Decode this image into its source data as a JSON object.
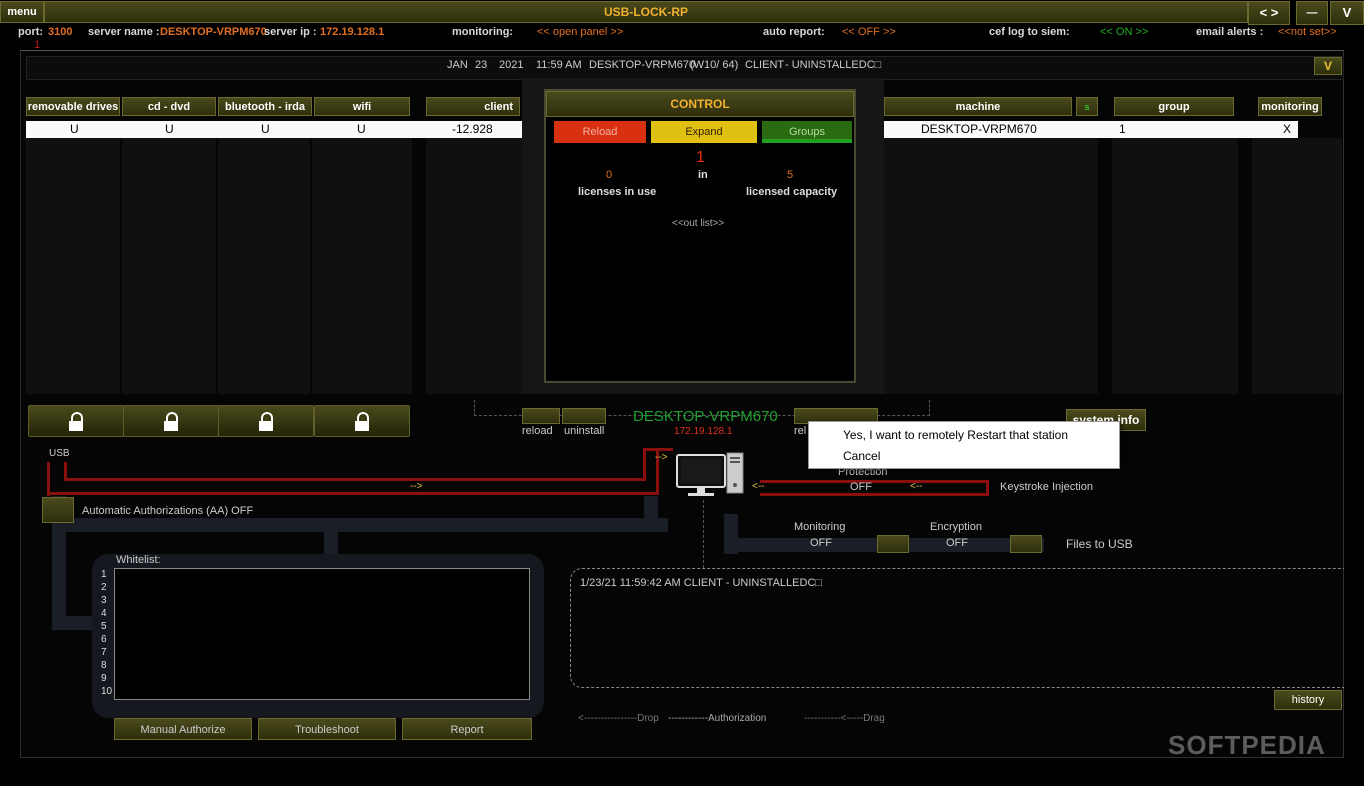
{
  "titlebar": {
    "menu": "menu",
    "title": "USB-LOCK-RP",
    "nav": "< >",
    "minimize": "—",
    "maximize": "V"
  },
  "statusbar": {
    "port_label": "port:",
    "port_value": "3100",
    "server_name_label": "server name :",
    "server_name_value": "DESKTOP-VRPM670",
    "server_ip_label": "server ip :",
    "server_ip_value": "172.19.128.1",
    "monitoring_label": "monitoring:",
    "monitoring_value": "<<  open panel >>",
    "auto_report_label": "auto report:",
    "auto_report_value": "<< OFF >>",
    "cef_label": "cef log to siem:",
    "cef_value": "<< ON >>",
    "email_label": "email alerts :",
    "email_value": "<<not set>>",
    "counter": "1"
  },
  "infobar": {
    "month": "JAN",
    "day": "23",
    "year": "2021",
    "time": "11:59 AM",
    "machine": "DESKTOP-VRPM670",
    "os": "(W10/ 64)",
    "client": "CLIENT",
    "status": "- UNINSTALLEDC□",
    "dropdown": "V"
  },
  "table": {
    "headers": {
      "removable": "removable drives",
      "cddvd": "cd - dvd",
      "bluetooth": "bluetooth -  irda",
      "wifi": "wifi",
      "client": "client",
      "machine": "machine",
      "s": "s",
      "group": "group",
      "monitoring": "monitoring"
    },
    "row": {
      "removable": "U",
      "cddvd": "U",
      "bluetooth": "U",
      "wifi": "U",
      "client": "-12.928",
      "machine": "DESKTOP-VRPM670",
      "group": "1",
      "monitoring": "X"
    }
  },
  "control": {
    "title": "CONTROL",
    "reload": "Reload",
    "expand": "Expand",
    "groups": "Groups",
    "count": "1",
    "licenses_in_use_value": "0",
    "in": "in",
    "capacity_value": "5",
    "licenses_in_use": "licenses in use",
    "licensed_capacity": "licensed capacity",
    "out_list": "<<out list>>"
  },
  "station": {
    "name": "DESKTOP-VRPM670",
    "ip": "172.19.128.1",
    "reload": "reload",
    "uninstall": "uninstall",
    "rel_partial": "rel",
    "system_info": "system info"
  },
  "context_menu": {
    "restart": "Yes, I want to remotely Restart that station",
    "cancel": "Cancel"
  },
  "flow": {
    "usb": "USB",
    "arrow_right": "-->",
    "arrow_left": "<--",
    "auto_auth": "Automatic Authorizations (AA) OFF",
    "protection": "Protection",
    "protection_value": "OFF",
    "keystroke": "Keystroke Injection",
    "monitoring": "Monitoring",
    "monitoring_value": "OFF",
    "encryption": "Encryption",
    "encryption_value": "OFF",
    "files_to_usb": "Files to USB"
  },
  "whitelist": {
    "title": "Whitelist:",
    "numbers": [
      "1",
      "2",
      "3",
      "4",
      "5",
      "6",
      "7",
      "8",
      "9",
      "10"
    ]
  },
  "log": {
    "entry": "1/23/21 11:59:42 AM CLIENT  - UNINSTALLEDC□",
    "history": "history"
  },
  "bottom": {
    "manual_authorize": "Manual Authorize",
    "troubleshoot": "Troubleshoot",
    "report": "Report",
    "drop": "<----------------Drop",
    "authorization": "------------Authorization",
    "drag": "-----------<-----Drag"
  },
  "watermark": "SOFTPEDIA",
  "colors": {
    "accent_orange": "#e07020",
    "on_green": "#20b020",
    "line_red": "#8a1010",
    "olive": "#3a3a14"
  }
}
